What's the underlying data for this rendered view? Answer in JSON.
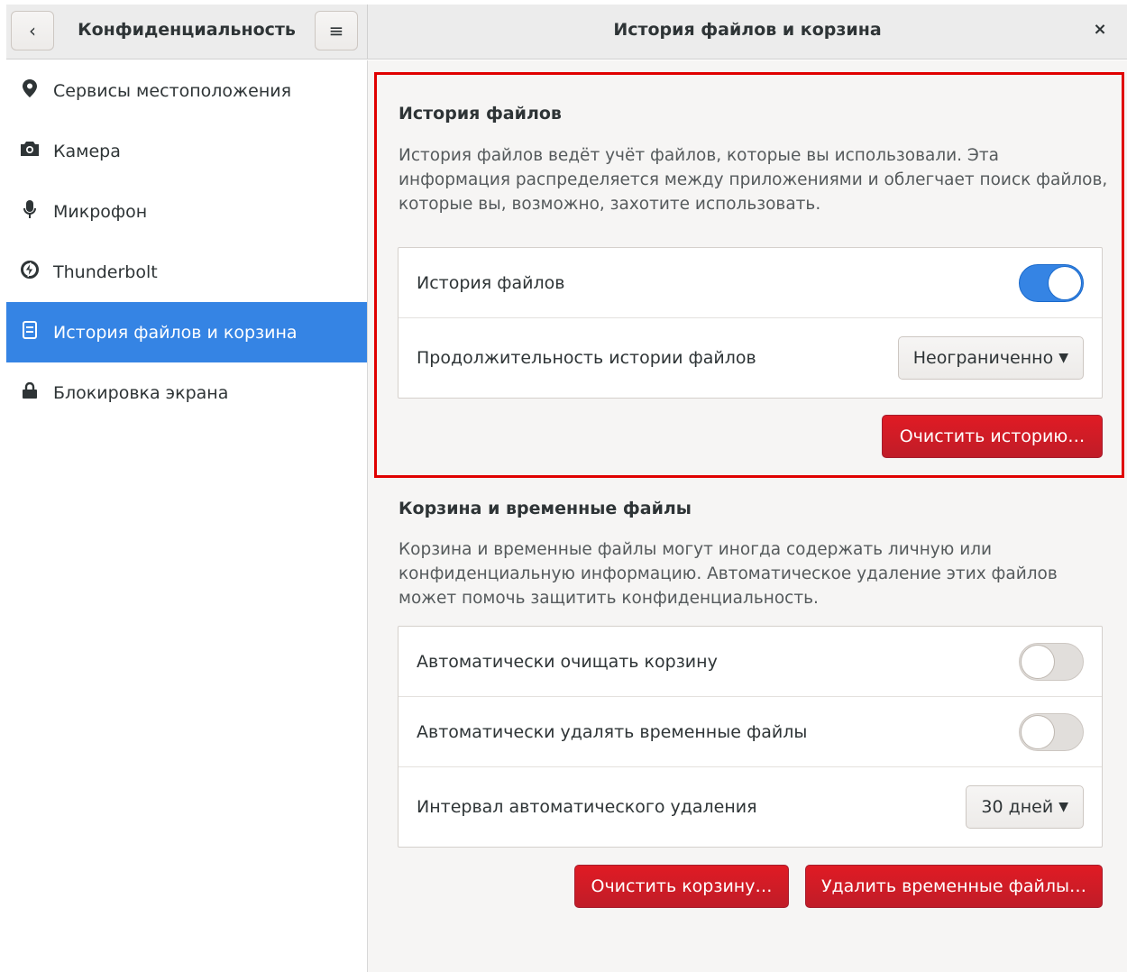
{
  "headerbar": {
    "left_title": "Конфиденциальность",
    "right_title": "История файлов и корзина",
    "back_icon": "‹",
    "menu_icon": "≡",
    "close_icon": "×"
  },
  "sidebar": {
    "items": [
      {
        "label": "Сервисы местоположения",
        "icon": "location-icon",
        "glyph": "⚲"
      },
      {
        "label": "Камера",
        "icon": "camera-icon",
        "glyph": "◙"
      },
      {
        "label": "Микрофон",
        "icon": "microphone-icon",
        "glyph": "⏺"
      },
      {
        "label": "Thunderbolt",
        "icon": "thunderbolt-icon",
        "glyph": "ϟ"
      },
      {
        "label": "История файлов и корзина",
        "icon": "file-history-icon",
        "glyph": "▤",
        "active": true
      },
      {
        "label": "Блокировка экрана",
        "icon": "lock-icon",
        "glyph": "▲"
      }
    ]
  },
  "file_history": {
    "title": "История файлов",
    "description": "История файлов ведёт учёт файлов, которые вы использовали. Эта информация распределяется между приложениями и облегчает поиск файлов, которые вы, возможно, захотите использовать.",
    "toggle_label": "История файлов",
    "toggle_on": true,
    "duration_label": "Продолжительность истории файлов",
    "duration_value": "Неограниченно",
    "clear_button": "Очистить историю…"
  },
  "trash": {
    "title": "Корзина и временные файлы",
    "description": "Корзина и временные файлы могут иногда содержать личную или конфиденциальную информацию. Автоматическое удаление этих файлов может помочь защитить конфиденциальность.",
    "auto_empty_label": "Автоматически очищать корзину",
    "auto_empty_on": false,
    "auto_delete_temp_label": "Автоматически удалять временные файлы",
    "auto_delete_temp_on": false,
    "interval_label": "Интервал автоматического удаления",
    "interval_value": "30 дней",
    "empty_trash_button": "Очистить корзину…",
    "delete_temp_button": "Удалить временные файлы…"
  },
  "colors": {
    "accent": "#3584e4",
    "destructive": "#e01b24",
    "highlight_frame": "#e00000"
  }
}
